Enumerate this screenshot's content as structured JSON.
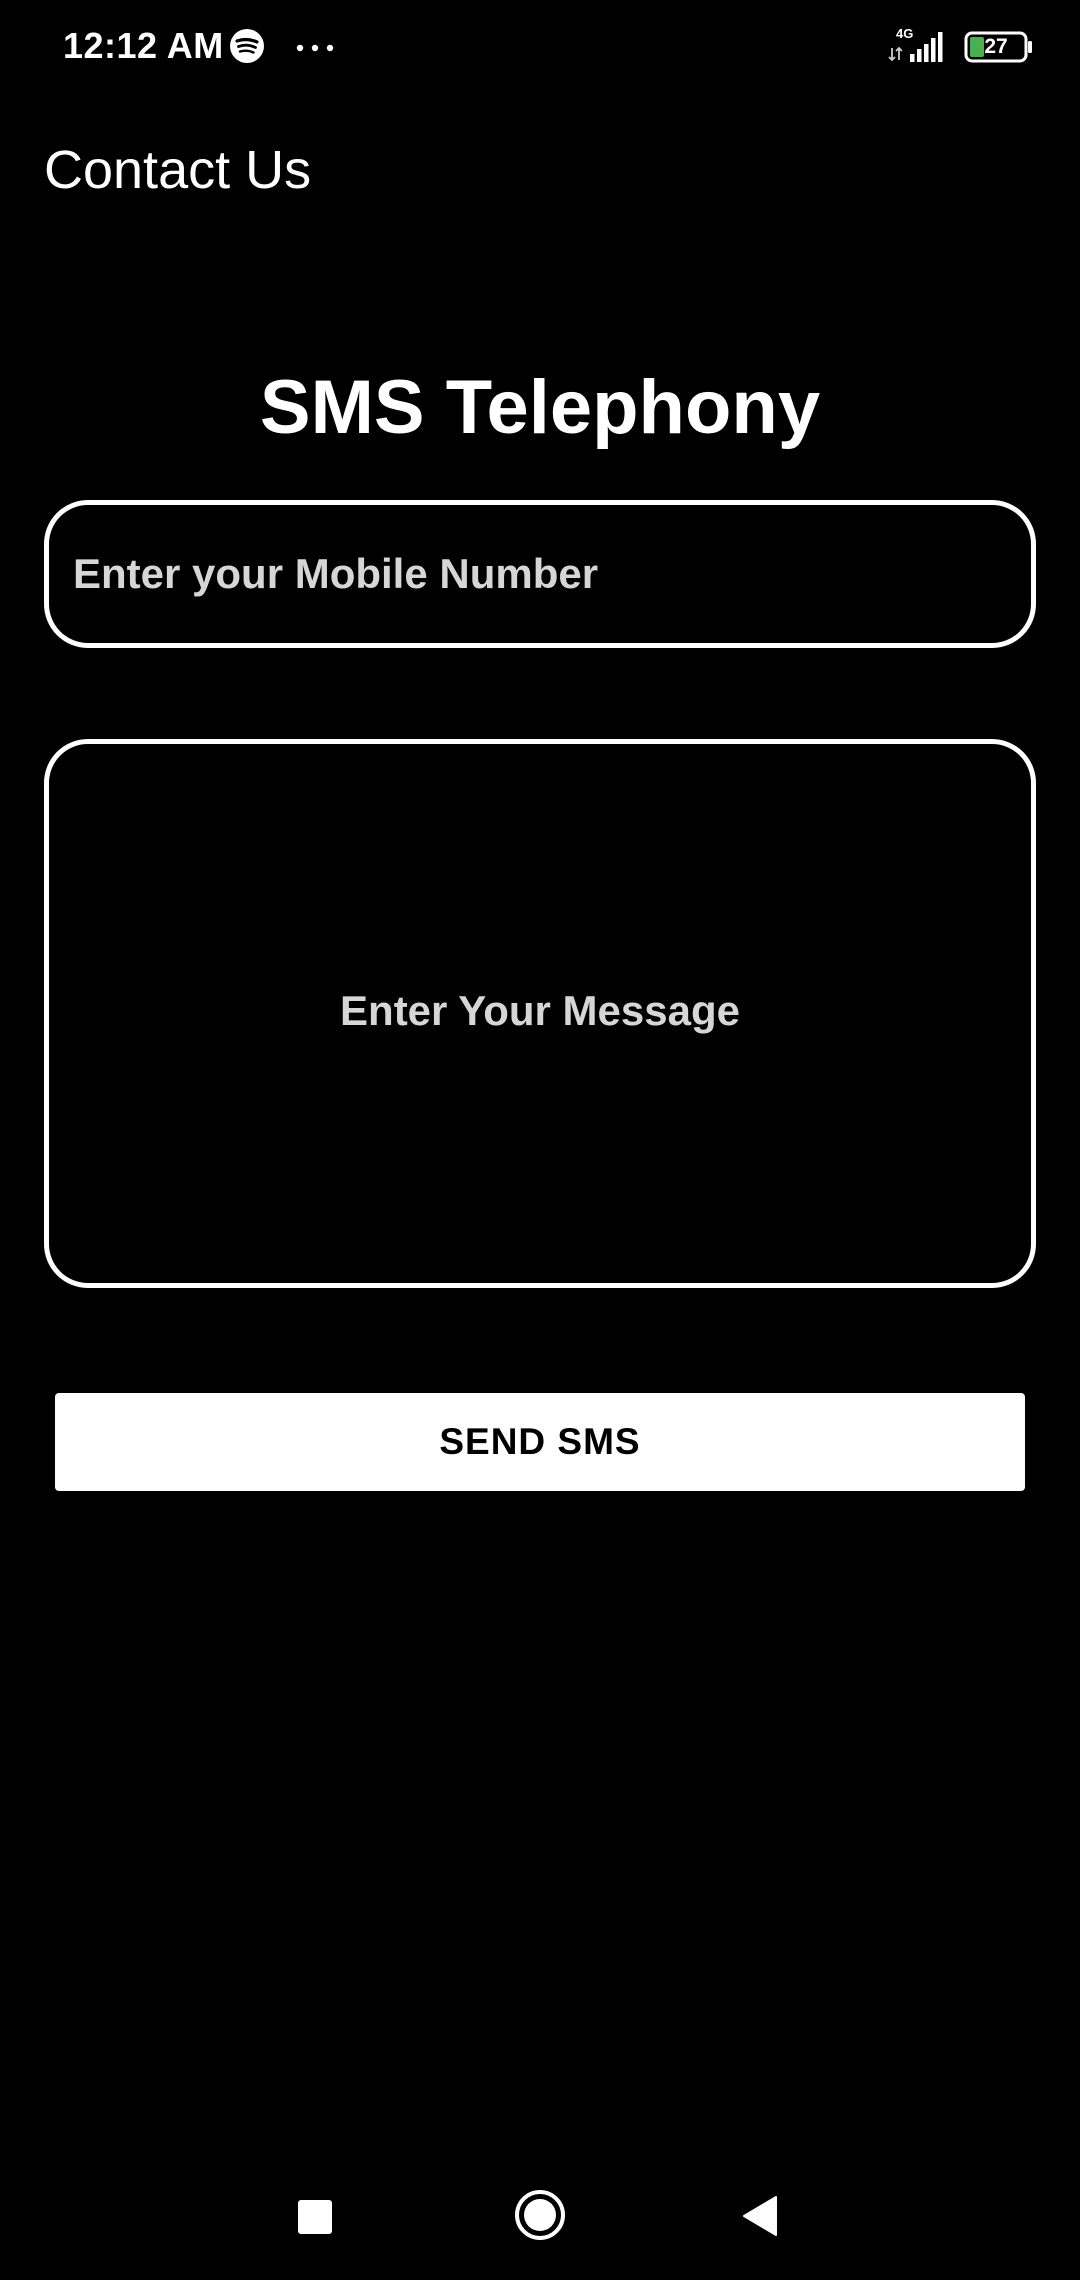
{
  "status_bar": {
    "time": "12:12 AM",
    "network_type": "4G",
    "battery_level": "27",
    "icons": [
      "spotify-icon",
      "more-dots-icon",
      "signal-icon",
      "battery-icon"
    ]
  },
  "app_bar": {
    "title": "Contact Us"
  },
  "main": {
    "heading": "SMS Telephony",
    "mobile_number": {
      "value": "",
      "placeholder": "Enter your Mobile Number"
    },
    "message": {
      "value": "",
      "placeholder": "Enter Your Message"
    },
    "send_label": "SEND SMS"
  },
  "nav_bar": {
    "icons": [
      "recents-icon",
      "home-icon",
      "back-icon"
    ]
  },
  "colors": {
    "background": "#000000",
    "foreground": "#ffffff",
    "placeholder": "#d6d6d6",
    "battery_accent": "#4caf50"
  }
}
